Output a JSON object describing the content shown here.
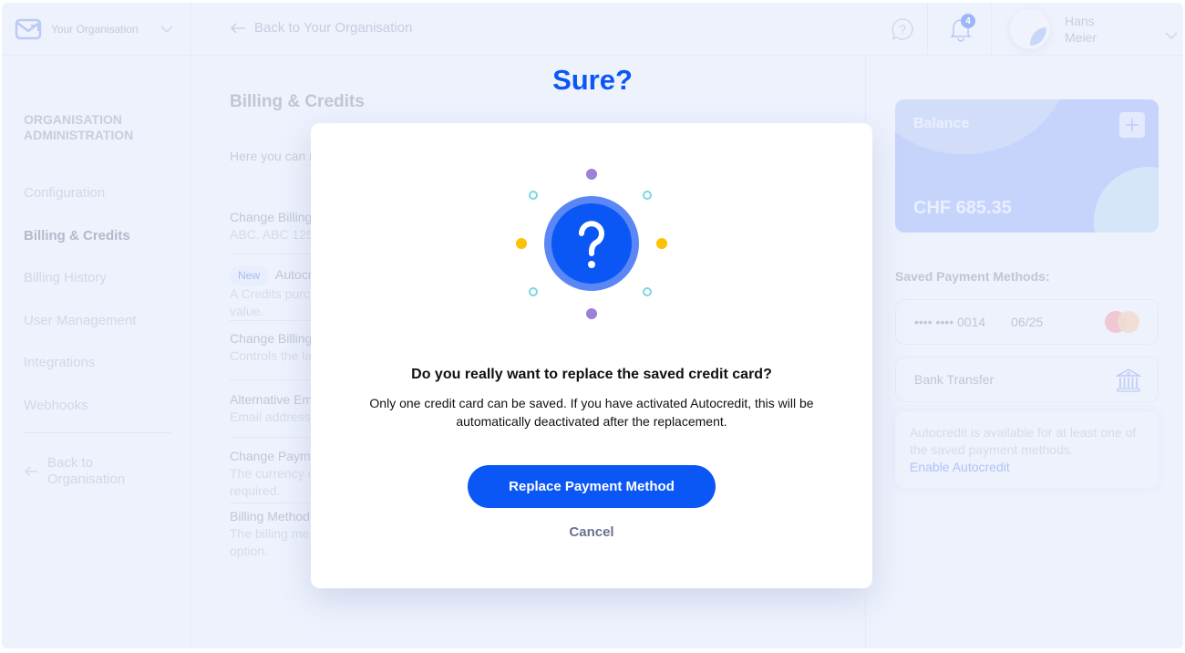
{
  "topbar": {
    "org_name": "Your Organisation",
    "back_link": "Back to Your Organisation",
    "notification_count": "4",
    "user_first_name": "Hans",
    "user_last_name": "Meier"
  },
  "sidebar": {
    "title_line1": "ORGANISATION",
    "title_line2": "ADMINISTRATION",
    "items": [
      {
        "label": "Configuration",
        "active": false
      },
      {
        "label": "Billing & Credits",
        "active": true
      },
      {
        "label": "Billing History",
        "active": false
      },
      {
        "label": "User Management",
        "active": false
      },
      {
        "label": "Integrations",
        "active": false
      },
      {
        "label": "Webhooks",
        "active": false
      }
    ],
    "back_line1": "Back to",
    "back_line2": "Organisation"
  },
  "main": {
    "title": "Billing & Credits",
    "intro": "Here you can m",
    "settings": [
      {
        "title": "Change Billing",
        "desc": "ABC, ABC 125"
      },
      {
        "badge": "New",
        "title": "Autocr",
        "desc": "A Credits purc",
        "desc2": "value."
      },
      {
        "title": "Change Billing",
        "desc": "Controls the la"
      },
      {
        "title": "Alternative Em",
        "desc": "Email address"
      },
      {
        "title": "Change Paym",
        "desc": "The currency c",
        "desc2": "required."
      },
      {
        "title": "Billing Method",
        "desc": "The billing me",
        "desc2": "option."
      }
    ]
  },
  "right_panel": {
    "balance_label": "Balance",
    "balance_amount": "CHF 685.35",
    "saved_methods_title": "Saved Payment Methods:",
    "card_number": "•••• •••• 0014",
    "card_expiry": "06/25",
    "bank_transfer": "Bank Transfer",
    "autocredit_text": "Autocredit is available for at least one of the saved payment methods.",
    "autocredit_link": "Enable Autocredit"
  },
  "modal": {
    "heading": "Sure?",
    "question": "Do you really want to replace the saved credit card?",
    "text": "Only one credit card can be saved. If you have activated Autocredit, this will be automatically deactivated after the replacement.",
    "primary_button": "Replace Payment Method",
    "cancel_button": "Cancel",
    "accent_color": "#0b57f5"
  }
}
